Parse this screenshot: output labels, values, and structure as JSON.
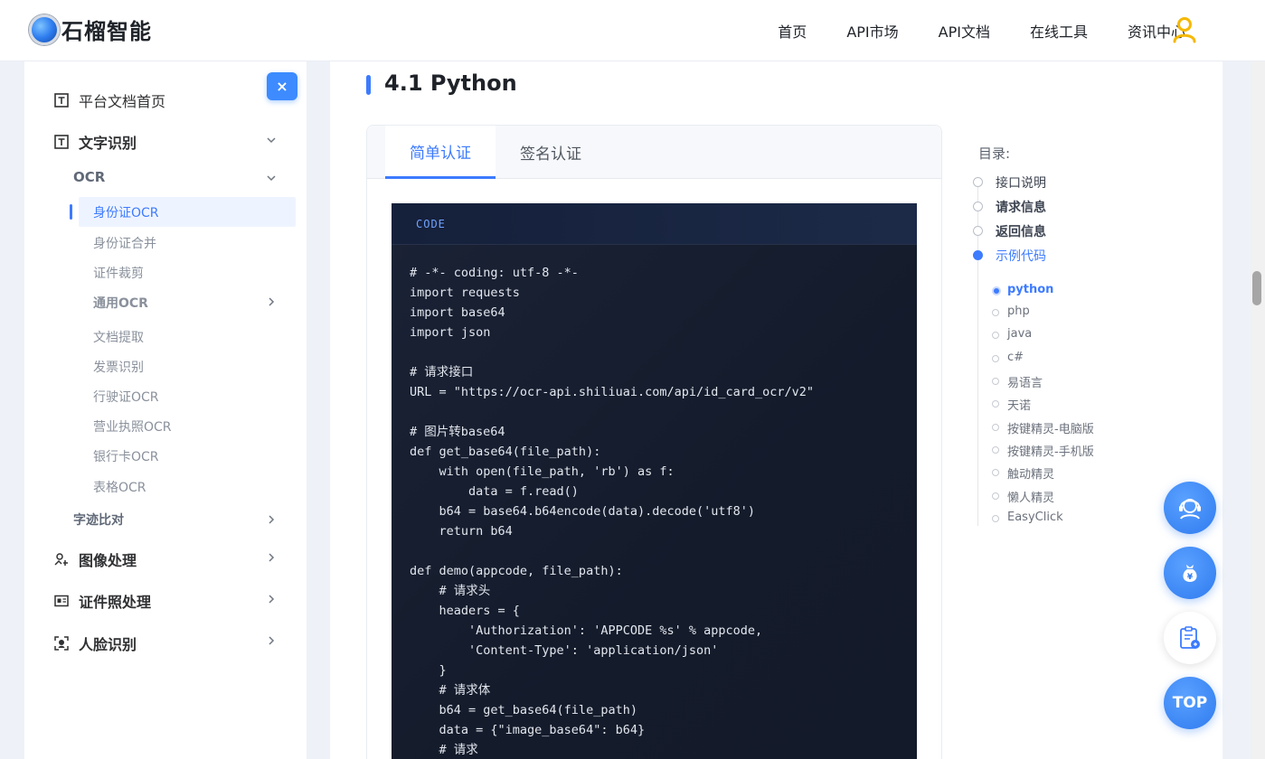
{
  "header": {
    "logo_text": "石榴智能",
    "nav": [
      "首页",
      "API市场",
      "API文档",
      "在线工具",
      "资讯中心"
    ]
  },
  "sidebar": {
    "close_label": "×",
    "home": "平台文档首页",
    "text_recognition": "文字识别",
    "ocr": "OCR",
    "ocr_items": [
      "身份证OCR",
      "身份证合并",
      "证件裁剪"
    ],
    "general_ocr": "通用OCR",
    "ocr_items2": [
      "文档提取",
      "发票识别",
      "行驶证OCR",
      "营业执照OCR",
      "银行卡OCR",
      "表格OCR"
    ],
    "handwriting": "字迹比对",
    "image_processing": "图像处理",
    "id_photo": "证件照处理",
    "face": "人脸识别"
  },
  "main": {
    "section_title": "4.1 Python",
    "tabs": [
      "简单认证",
      "签名认证"
    ],
    "code_label": "CODE",
    "code_lines": [
      "# -*- coding: utf-8 -*-",
      "import requests",
      "import base64",
      "import json",
      "",
      "# 请求接口",
      "URL = \"https://ocr-api.shiliuai.com/api/id_card_ocr/v2\"",
      "",
      "# 图片转base64",
      "def get_base64(file_path):",
      "    with open(file_path, 'rb') as f:",
      "        data = f.read()",
      "    b64 = base64.b64encode(data).decode('utf8')",
      "    return b64",
      "",
      "def demo(appcode, file_path):",
      "    # 请求头",
      "    headers = {",
      "        'Authorization': 'APPCODE %s' % appcode,",
      "        'Content-Type': 'application/json'",
      "    }",
      "    # 请求体",
      "    b64 = get_base64(file_path)",
      "    data = {\"image_base64\": b64}",
      "    # 请求"
    ]
  },
  "toc": {
    "title": "目录:",
    "items": [
      "接口说明",
      "请求信息",
      "返回信息",
      "示例代码"
    ],
    "sub_items": [
      "python",
      "php",
      "java",
      "c#",
      "易语言",
      "天诺",
      "按键精灵-电脑版",
      "按键精灵-手机版",
      "触动精灵",
      "懒人精灵",
      "EasyClick"
    ]
  },
  "floating": {
    "top_label": "TOP"
  },
  "colors": {
    "accent": "#3d7bff",
    "code_bg": "#141b2b"
  }
}
